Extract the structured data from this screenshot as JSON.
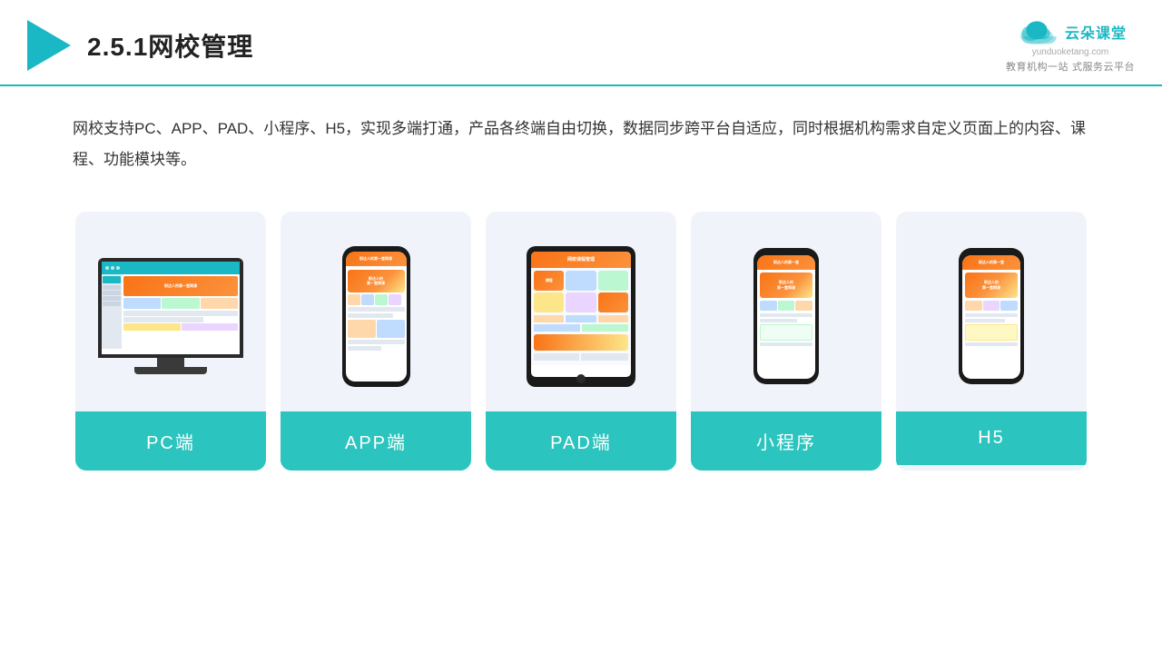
{
  "header": {
    "title": "2.5.1网校管理",
    "logo_main": "云朵课堂",
    "logo_url": "yunduoketang.com",
    "logo_tagline_line1": "教育机构一站",
    "logo_tagline_line2": "式服务云平台"
  },
  "description": {
    "text": "网校支持PC、APP、PAD、小程序、H5，实现多端打通，产品各终端自由切换，数据同步跨平台自适应，同时根据机构需求自定义页面上的内容、课程、功能模块等。"
  },
  "cards": [
    {
      "id": "pc",
      "label": "PC端"
    },
    {
      "id": "app",
      "label": "APP端"
    },
    {
      "id": "pad",
      "label": "PAD端"
    },
    {
      "id": "miniapp",
      "label": "小程序"
    },
    {
      "id": "h5",
      "label": "H5"
    }
  ],
  "colors": {
    "accent": "#1ab8c4",
    "card_bg": "#eef2f8",
    "label_bg": "#2bc4be",
    "label_text": "#ffffff"
  }
}
